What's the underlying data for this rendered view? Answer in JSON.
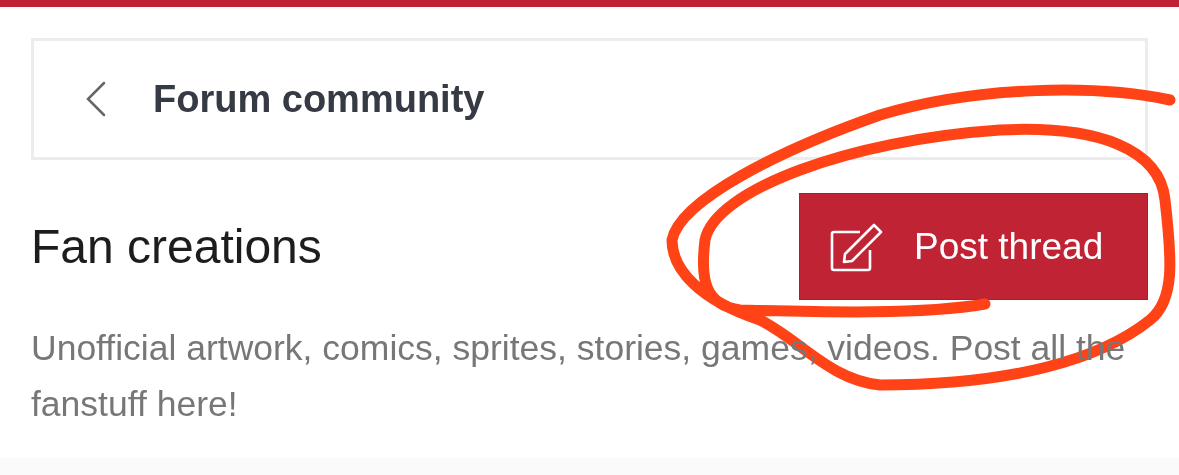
{
  "breadcrumb": {
    "label": "Forum community"
  },
  "forum": {
    "title": "Fan creations",
    "description": "Unofficial artwork, comics, sprites, stories, games, videos. Post all the fanstuff here!"
  },
  "post_button": {
    "label": "Post thread"
  }
}
